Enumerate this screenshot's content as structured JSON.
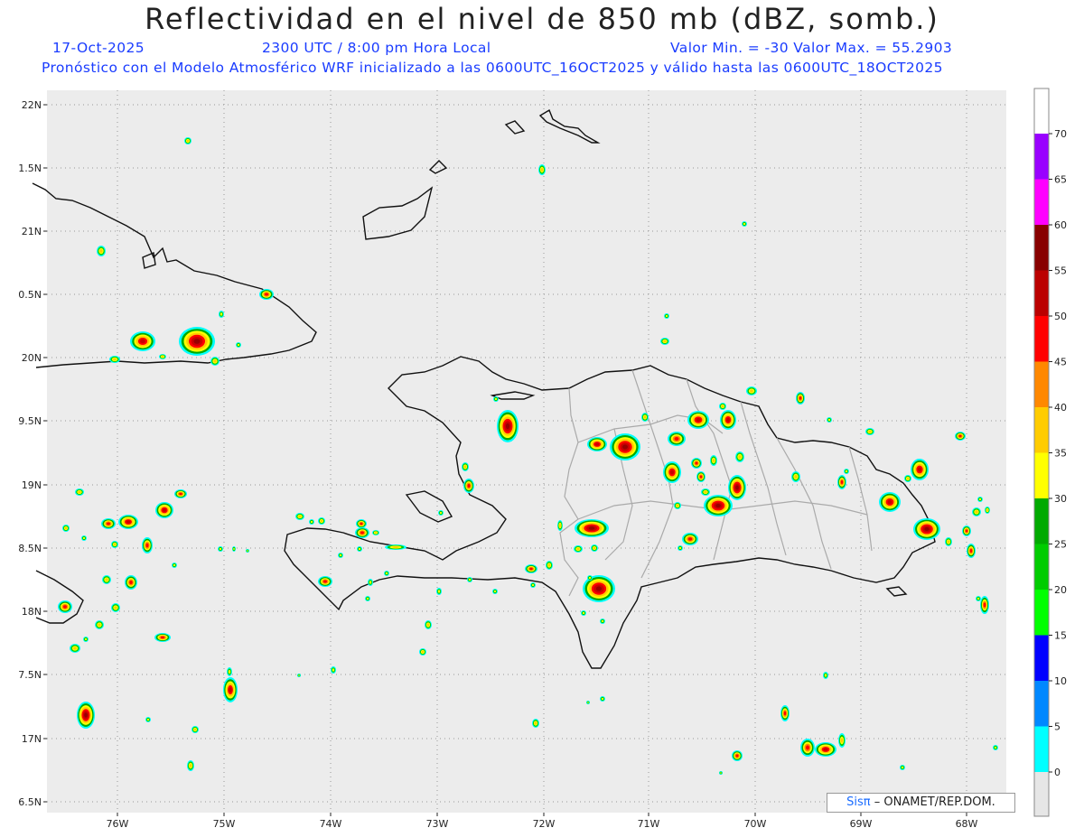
{
  "title": "Reflectividad en el nivel de 850 mb (dBZ, somb.)",
  "header": {
    "date": "17-Oct-2025",
    "time": "2300 UTC / 8:00 pm Hora Local",
    "minmax": "Valor Min. = -30  Valor Max. = 55.2903",
    "model_info": "Pronóstico con el Modelo Atmosférico WRF inicializado a las 0600UTC_16OCT2025 y válido hasta las  0600UTC_18OCT2025"
  },
  "axes": {
    "lat_labels": [
      "22N",
      "1.5N",
      "21N",
      "0.5N",
      "20N",
      "9.5N",
      "19N",
      "8.5N",
      "18N",
      "7.5N",
      "17N",
      "6.5N"
    ],
    "lon_labels": [
      "76W",
      "75W",
      "74W",
      "73W",
      "72W",
      "71W",
      "70W",
      "69W",
      "68W"
    ]
  },
  "colorbar": {
    "labels": [
      "70",
      "65",
      "60",
      "55",
      "50",
      "45",
      "40",
      "35",
      "30",
      "25",
      "20",
      "15",
      "10",
      "5",
      "0"
    ],
    "colors": [
      "#9900ff",
      "#ff00ff",
      "#880000",
      "#bb0000",
      "#ff0000",
      "#ff8800",
      "#ffcc00",
      "#ffff00",
      "#00aa00",
      "#00cc00",
      "#00ff00",
      "#0000ff",
      "#0088ff",
      "#00ffff"
    ]
  },
  "credit": {
    "sis": "Sisπ",
    "org": "– ONAMET/REP.DOM."
  }
}
